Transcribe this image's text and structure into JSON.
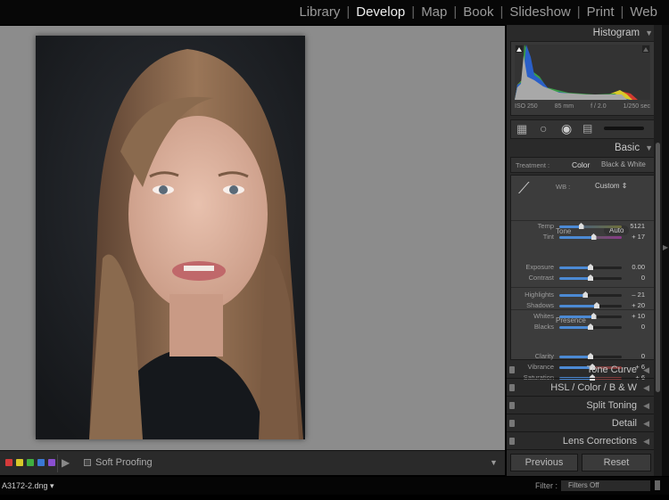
{
  "modules": [
    {
      "label": "Library",
      "active": false
    },
    {
      "label": "Develop",
      "active": true
    },
    {
      "label": "Map",
      "active": false
    },
    {
      "label": "Book",
      "active": false
    },
    {
      "label": "Slideshow",
      "active": false
    },
    {
      "label": "Print",
      "active": false
    },
    {
      "label": "Web",
      "active": false
    }
  ],
  "histogram": {
    "title": "Histogram",
    "iso": "ISO 250",
    "focal": "85 mm",
    "aperture": "f / 2.0",
    "shutter": "1/250 sec"
  },
  "basic": {
    "title": "Basic",
    "treatment_label": "Treatment :",
    "treatment_color": "Color",
    "treatment_bw": "Black & White",
    "wb_label": "WB :",
    "wb_value": "Custom",
    "tone_label": "Tone",
    "auto_label": "Auto",
    "presence_label": "Presence",
    "sliders": [
      {
        "label": "Temp",
        "value": "5121",
        "position": 0.35,
        "group": "wb"
      },
      {
        "label": "Tint",
        "value": "+ 17",
        "position": 0.55,
        "group": "wb"
      },
      {
        "label": "Exposure",
        "value": "0.00",
        "position": 0.5,
        "group": "tone"
      },
      {
        "label": "Contrast",
        "value": "0",
        "position": 0.5,
        "group": "tone"
      },
      {
        "label": "Highlights",
        "value": "– 21",
        "position": 0.42,
        "group": "tone2"
      },
      {
        "label": "Shadows",
        "value": "+ 20",
        "position": 0.6,
        "group": "tone2"
      },
      {
        "label": "Whites",
        "value": "+ 10",
        "position": 0.55,
        "group": "tone2"
      },
      {
        "label": "Blacks",
        "value": "0",
        "position": 0.5,
        "group": "tone2"
      },
      {
        "label": "Clarity",
        "value": "0",
        "position": 0.5,
        "group": "presence"
      },
      {
        "label": "Vibrance",
        "value": "+ 6",
        "position": 0.53,
        "group": "presence"
      },
      {
        "label": "Saturation",
        "value": "+ 6",
        "position": 0.53,
        "group": "presence"
      }
    ]
  },
  "panels": [
    "Tone Curve",
    "HSL  /  Color  /  B & W",
    "Split Toning",
    "Detail",
    "Lens Corrections"
  ],
  "buttons": {
    "previous": "Previous",
    "reset": "Reset"
  },
  "toolbar": {
    "soft_proofing": "Soft Proofing",
    "color_labels": [
      "#d43a3a",
      "#d8c92a",
      "#3fae3f",
      "#3a78d4",
      "#8a4fd0"
    ]
  },
  "filmstrip": {
    "filename": "A3172-2.dng",
    "filter_label": "Filter :",
    "filter_value": "Filters Off"
  }
}
